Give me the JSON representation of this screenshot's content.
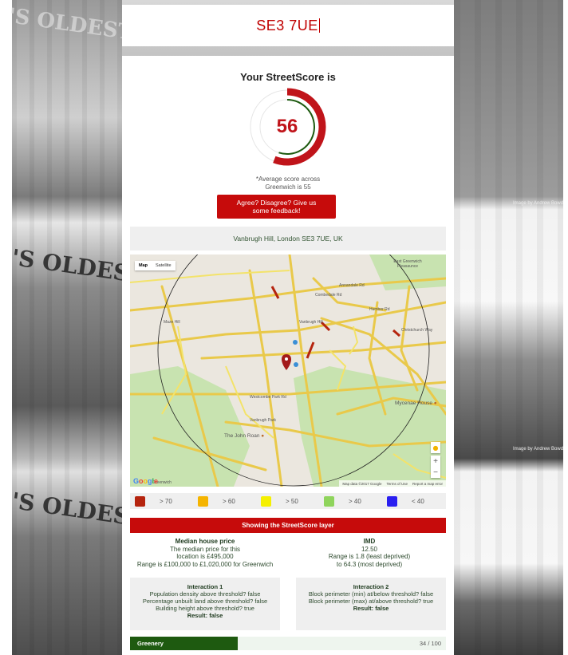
{
  "background": {
    "sign_text": "'S OLDEST B",
    "credit_top": "Image by Andrew Bowd",
    "credit_bottom": "Image by Andrew Bowd"
  },
  "search": {
    "value": "SE3 7UE"
  },
  "score": {
    "title": "Your StreetScore is",
    "value": "56",
    "fraction": 0.56,
    "average_note_line1": "*Average score across",
    "average_note_line2": "Greenwich is 55",
    "colors": {
      "ring_red": "#c0141a",
      "ring_green": "#1e5a10"
    }
  },
  "feedback": {
    "line1": "Agree? Disagree? Give us",
    "line2": "some feedback!"
  },
  "address": "Vanbrugh Hill, London SE3 7UE, UK",
  "map": {
    "type_map": "Map",
    "type_satellite": "Satellite",
    "labels": {
      "maze_hill": "Maze Hill",
      "mycenae_house": "Mycenae House",
      "john_roan": "The John Roan",
      "westcombe_park": "Westcombe Park Rd",
      "east_greenwich": "East Greenwich Pleasaunce",
      "humber": "Humber Rd",
      "vanburgh": "Vanbrugh Hill",
      "combedale": "Combedale Rd",
      "annandale": "Annandale Rd",
      "christchurch": "Christchurch Way",
      "greenwich": "Greenwich",
      "vanbrugh_park": "Vanbrugh Park"
    },
    "footer": {
      "data": "Map data ©2017 Google",
      "terms": "Terms of Use",
      "report": "Report a map error"
    },
    "google": "Google"
  },
  "legend": [
    {
      "label": "> 70",
      "color": "#b5240e"
    },
    {
      "label": "> 60",
      "color": "#f5b400"
    },
    {
      "label": "> 50",
      "color": "#f5f000"
    },
    {
      "label": "> 40",
      "color": "#8fd45c"
    },
    {
      "label": "< 40",
      "color": "#2a1ff0"
    }
  ],
  "layer_bar": "Showing the StreetScore layer",
  "median_price": {
    "heading": "Median house price",
    "line1": "The median price for this",
    "line2": "location is £495,000",
    "line3": "Range is £100,000 to £1,020,000 for Greenwich"
  },
  "imd": {
    "heading": "IMD",
    "line1": "12.50",
    "line2": "Range is 1.8 (least deprived)",
    "line3": "to 64.3 (most deprived)"
  },
  "interaction1": {
    "heading": "Interaction 1",
    "line1": "Population density above threshold? false",
    "line2": "Percentage unbuilt land above threshold? false",
    "line3": "Building height above threshold? true",
    "result": "Result: false"
  },
  "interaction2": {
    "heading": "Interaction 2",
    "line1": "Block perimeter (min) at/below threshold? false",
    "line2": "Block perimeter (max) at/above threshold? true",
    "result": "Result: false"
  },
  "greenery": {
    "label": "Greenery",
    "score_text": "34 / 100",
    "fraction": 0.34
  }
}
